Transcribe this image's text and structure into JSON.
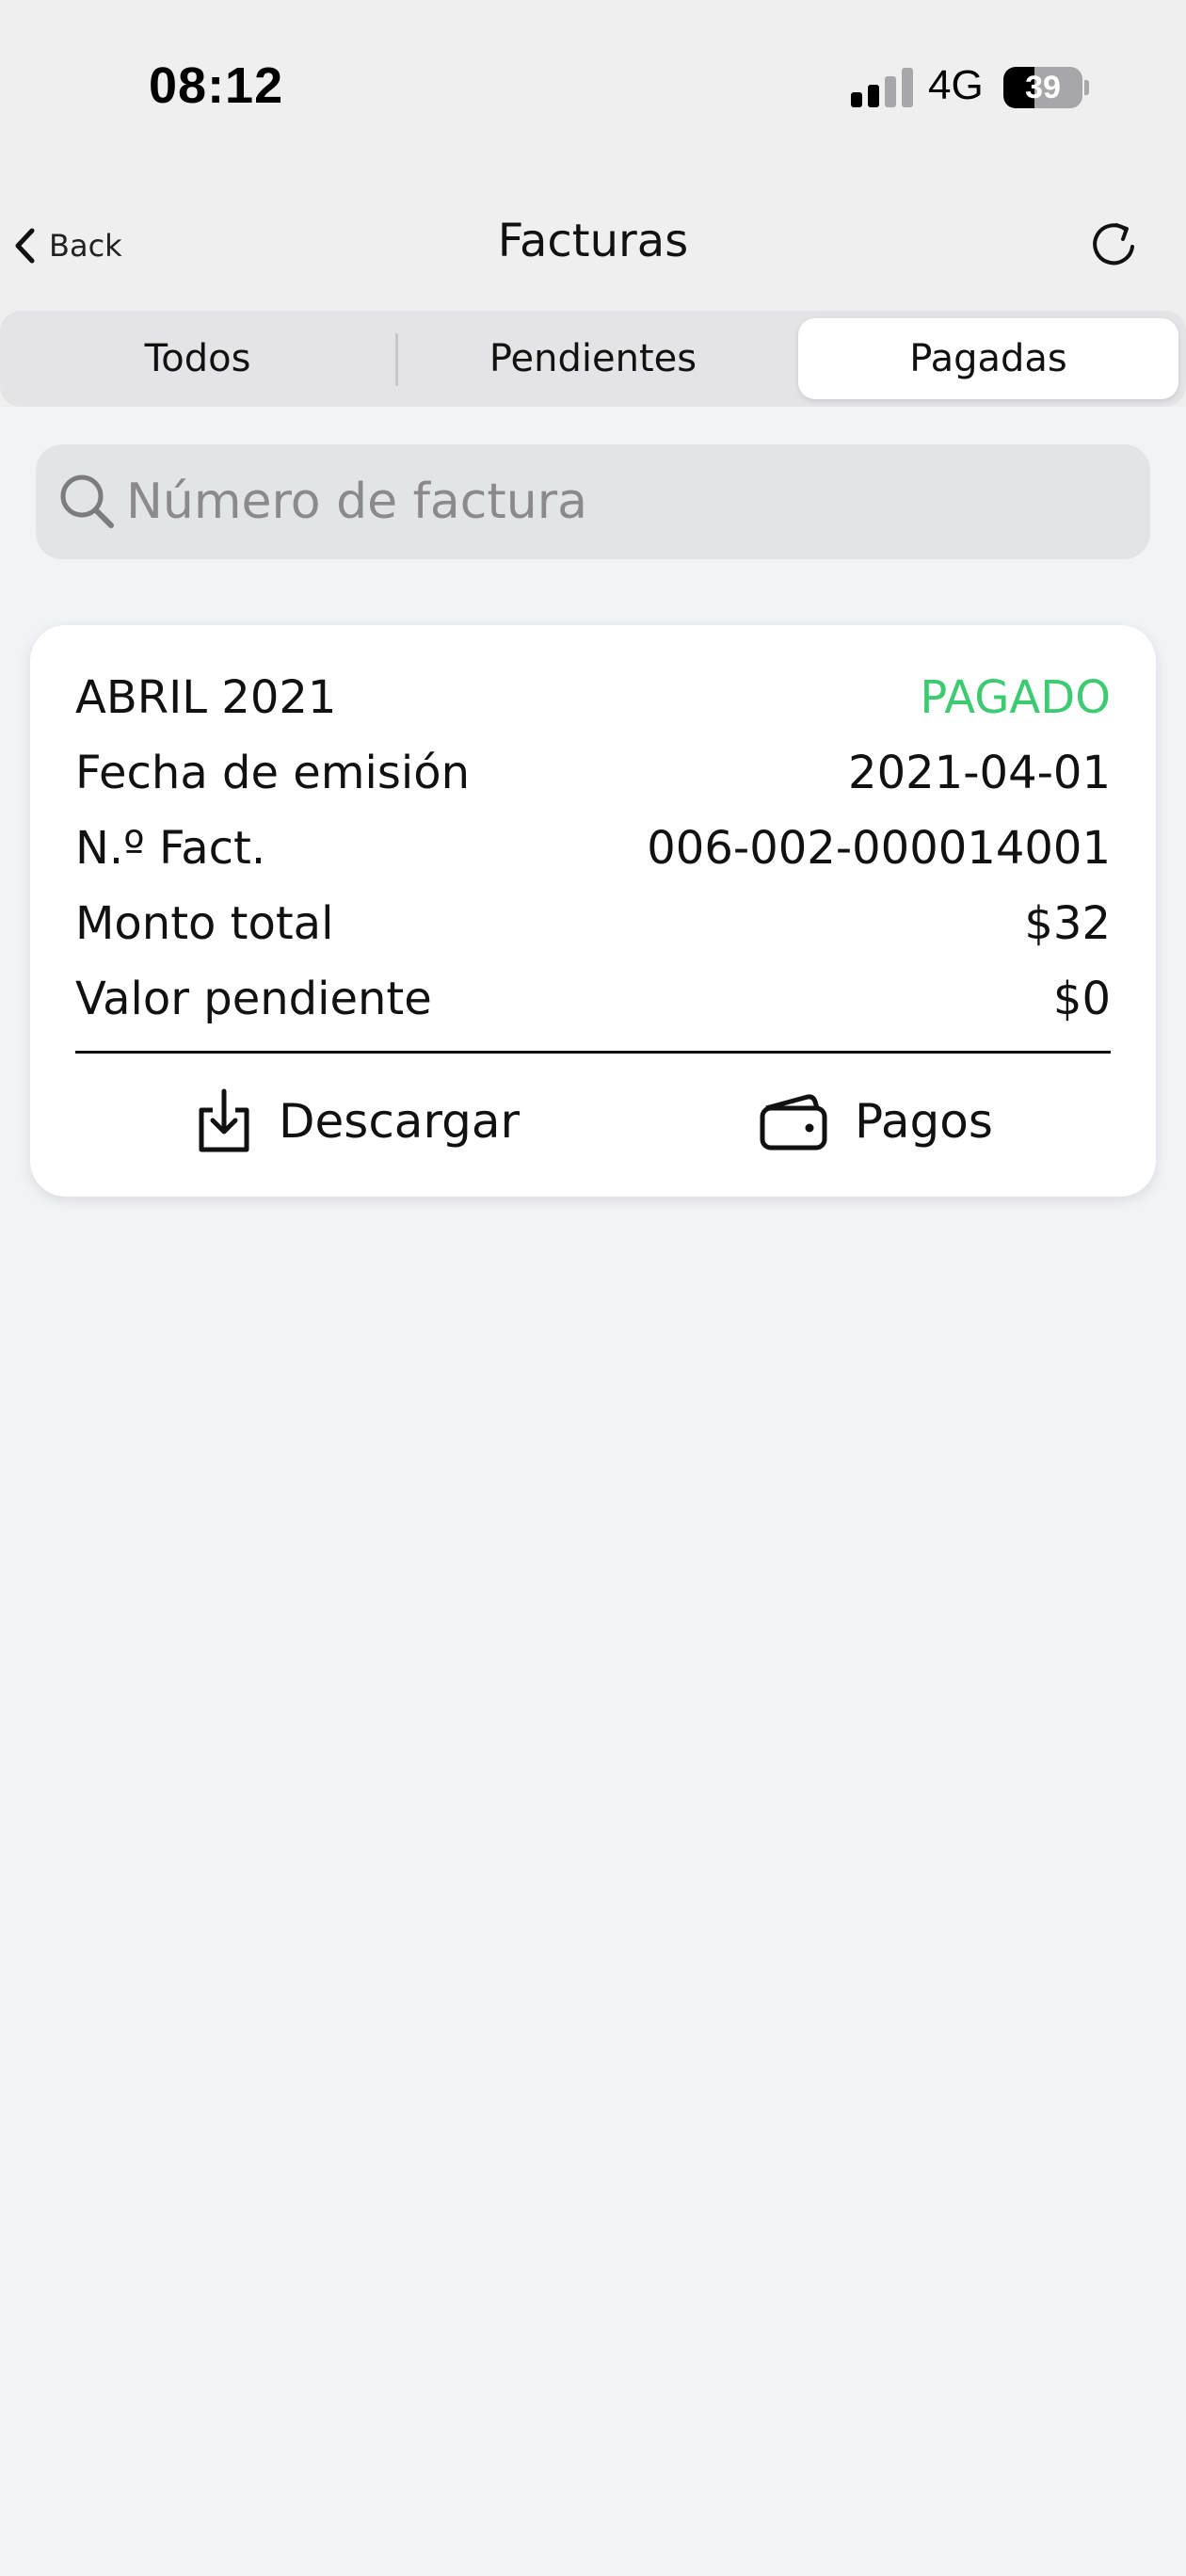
{
  "status_bar": {
    "time": "08:12",
    "network": "4G",
    "battery": "39",
    "battery_level": 0.39
  },
  "nav": {
    "back_label": "Back",
    "title": "Facturas",
    "back_icon": "chevron-left-icon",
    "refresh_icon": "refresh-icon"
  },
  "tabs": [
    {
      "label": "Todos",
      "selected": false
    },
    {
      "label": "Pendientes",
      "selected": false
    },
    {
      "label": "Pagadas",
      "selected": true
    }
  ],
  "search": {
    "placeholder": "Número de factura",
    "value": "",
    "icon": "search-icon"
  },
  "invoices": [
    {
      "period": "ABRIL 2021",
      "status": "PAGADO",
      "status_color": "#3dcb72",
      "fields": [
        {
          "label": "Fecha de emisión",
          "value": "2021-04-01"
        },
        {
          "label": "N.º Fact.",
          "value": "006-002-000014001"
        },
        {
          "label": "Monto total",
          "value": "$32"
        },
        {
          "label": "Valor pendiente",
          "value": "$0"
        }
      ],
      "actions": [
        {
          "label": "Descargar",
          "icon": "download-icon"
        },
        {
          "label": "Pagos",
          "icon": "wallet-icon"
        }
      ]
    }
  ]
}
